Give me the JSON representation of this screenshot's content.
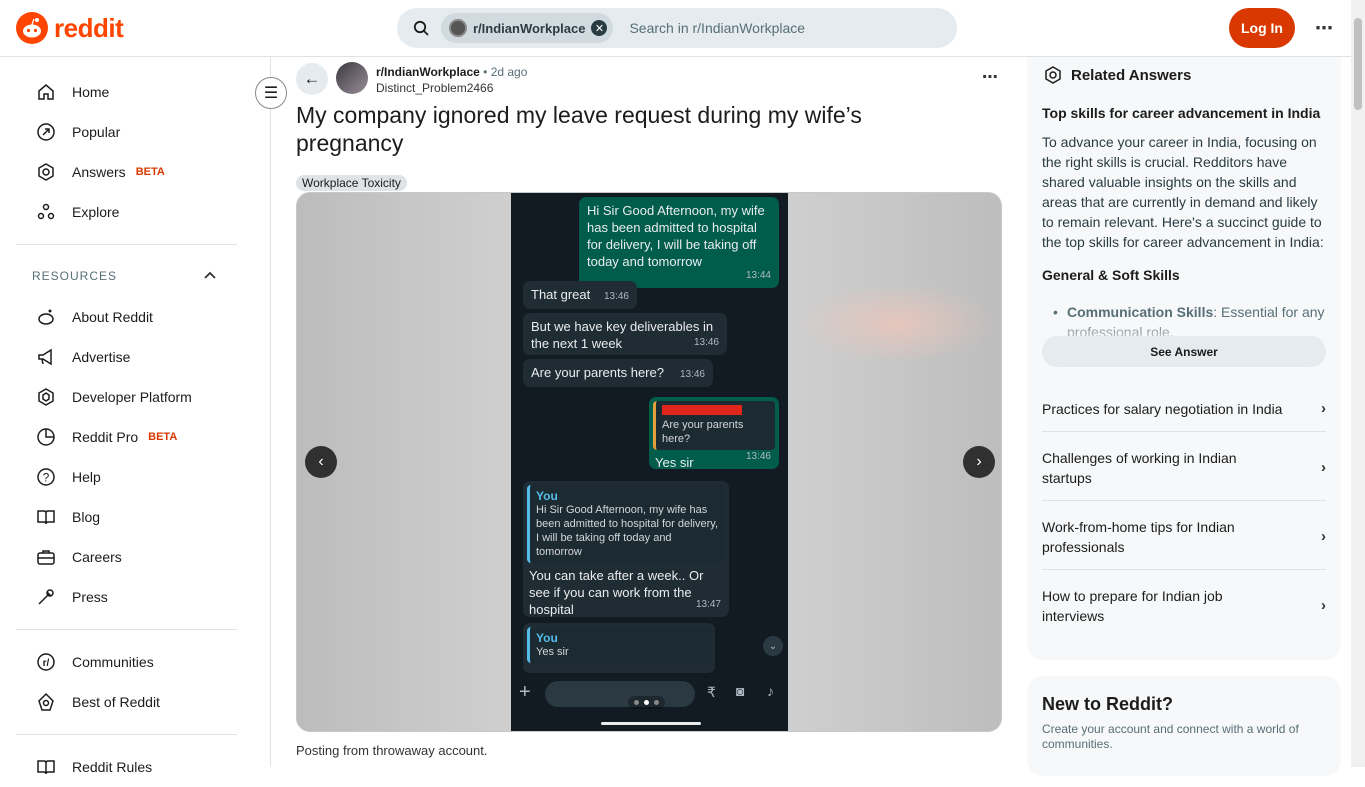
{
  "header": {
    "logo_text": "reddit",
    "search_chip": "r/IndianWorkplace",
    "search_placeholder": "Search in r/IndianWorkplace",
    "login_label": "Log In"
  },
  "sidebar": {
    "items": [
      {
        "label": "Home",
        "icon": "home-icon"
      },
      {
        "label": "Popular",
        "icon": "popular-icon"
      },
      {
        "label": "Answers",
        "badge": "BETA",
        "icon": "answers-icon"
      },
      {
        "label": "Explore",
        "icon": "explore-icon"
      }
    ],
    "resources_title": "RESOURCES",
    "resources": [
      {
        "label": "About Reddit"
      },
      {
        "label": "Advertise"
      },
      {
        "label": "Developer Platform"
      },
      {
        "label": "Reddit Pro",
        "badge": "BETA"
      },
      {
        "label": "Help"
      },
      {
        "label": "Blog"
      },
      {
        "label": "Careers"
      },
      {
        "label": "Press"
      }
    ],
    "community": [
      {
        "label": "Communities"
      },
      {
        "label": "Best of Reddit"
      }
    ],
    "rules": "Reddit Rules"
  },
  "post": {
    "subreddit": "r/IndianWorkplace",
    "separator": "•",
    "time": "2d ago",
    "author": "Distinct_Problem2466",
    "title": "My company ignored my leave request during my wife’s pregnancy",
    "flair": "Workplace Toxicity",
    "body": "Posting from throwaway account.",
    "chat": {
      "m1": "Hi Sir Good Afternoon, my wife has been admitted to hospital for delivery, I will be taking off today and tomorrow",
      "m1_time": "13:44",
      "m2": "That great",
      "m2_time": "13:46",
      "m3": "But we have key deliverables in the next 1 week",
      "m3_time": "13:46",
      "m4": "Are your parents here?",
      "m4_time": "13:46",
      "m5_quote": "Are your parents here?",
      "m5": "Yes sir",
      "m5_time": "13:46",
      "m6_quote_name": "You",
      "m6_quote": "Hi Sir Good Afternoon, my wife has been admitted to hospital for delivery, I will be taking off today and tomorrow",
      "m6": "You can take after a week.. Or see if you can work from the hospital",
      "m6_time": "13:47",
      "m7_quote_name": "You",
      "m7_quote": "Yes sir"
    }
  },
  "related": {
    "title": "Related Answers",
    "question": "Top skills for career advancement in India",
    "paragraph": "To advance your career in India, focusing on the right skills is crucial. Redditors have shared valuable insights on the skills and areas that are currently in demand and likely to remain relevant. Here's a succinct guide to the top skills for career advancement in India:",
    "heading": "General & Soft Skills",
    "bullet_bold": "Communication Skills",
    "bullet_text": ": Essential for any professional role.",
    "see_answer": "See Answer",
    "items": [
      "Practices for salary negotiation in India",
      "Challenges of working in Indian startups",
      "Work-from-home tips for Indian professionals",
      "How to prepare for Indian job interviews"
    ]
  },
  "newbox": {
    "title": "New to Reddit?",
    "subtitle": "Create your account and connect with a world of communities."
  }
}
